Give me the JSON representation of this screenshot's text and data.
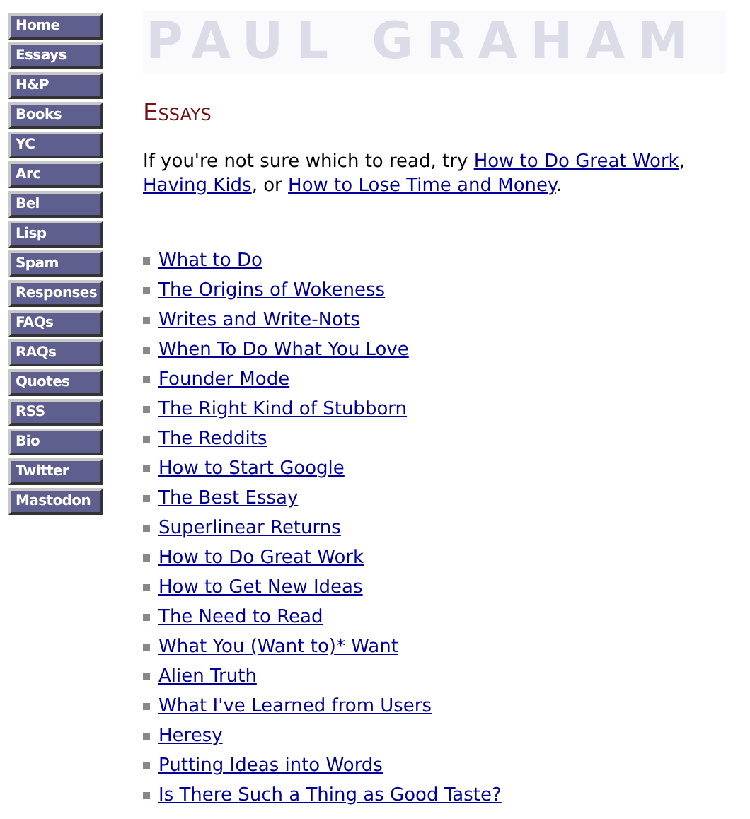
{
  "nav": [
    {
      "label": "Home"
    },
    {
      "label": "Essays"
    },
    {
      "label": "H&P"
    },
    {
      "label": "Books"
    },
    {
      "label": "YC"
    },
    {
      "label": "Arc"
    },
    {
      "label": "Bel"
    },
    {
      "label": "Lisp"
    },
    {
      "label": "Spam"
    },
    {
      "label": "Responses"
    },
    {
      "label": "FAQs"
    },
    {
      "label": "RAQs"
    },
    {
      "label": "Quotes"
    },
    {
      "label": "RSS"
    },
    {
      "label": "Bio"
    },
    {
      "label": "Twitter"
    },
    {
      "label": "Mastodon"
    }
  ],
  "header": {
    "logo": "PAUL GRAHAM"
  },
  "title": "Essays",
  "intro": [
    {
      "kind": "text",
      "text": "If you're not sure which to read, try "
    },
    {
      "kind": "link",
      "text": "How to Do Great Work"
    },
    {
      "kind": "text",
      "text": ", "
    },
    {
      "kind": "link",
      "text": "Having Kids"
    },
    {
      "kind": "text",
      "text": ", or "
    },
    {
      "kind": "link",
      "text": "How to Lose Time and Money"
    },
    {
      "kind": "text",
      "text": "."
    }
  ],
  "essays": [
    "What to Do",
    "The Origins of Wokeness",
    "Writes and Write-Nots",
    "When To Do What You Love",
    "Founder Mode",
    "The Right Kind of Stubborn",
    "The Reddits",
    "How to Start Google",
    "The Best Essay",
    "Superlinear Returns",
    "How to Do Great Work",
    "How to Get New Ideas",
    "The Need to Read",
    "What You (Want to)* Want",
    "Alien Truth",
    "What I've Learned from Users",
    "Heresy",
    "Putting Ideas into Words",
    "Is There Such a Thing as Good Taste?"
  ]
}
